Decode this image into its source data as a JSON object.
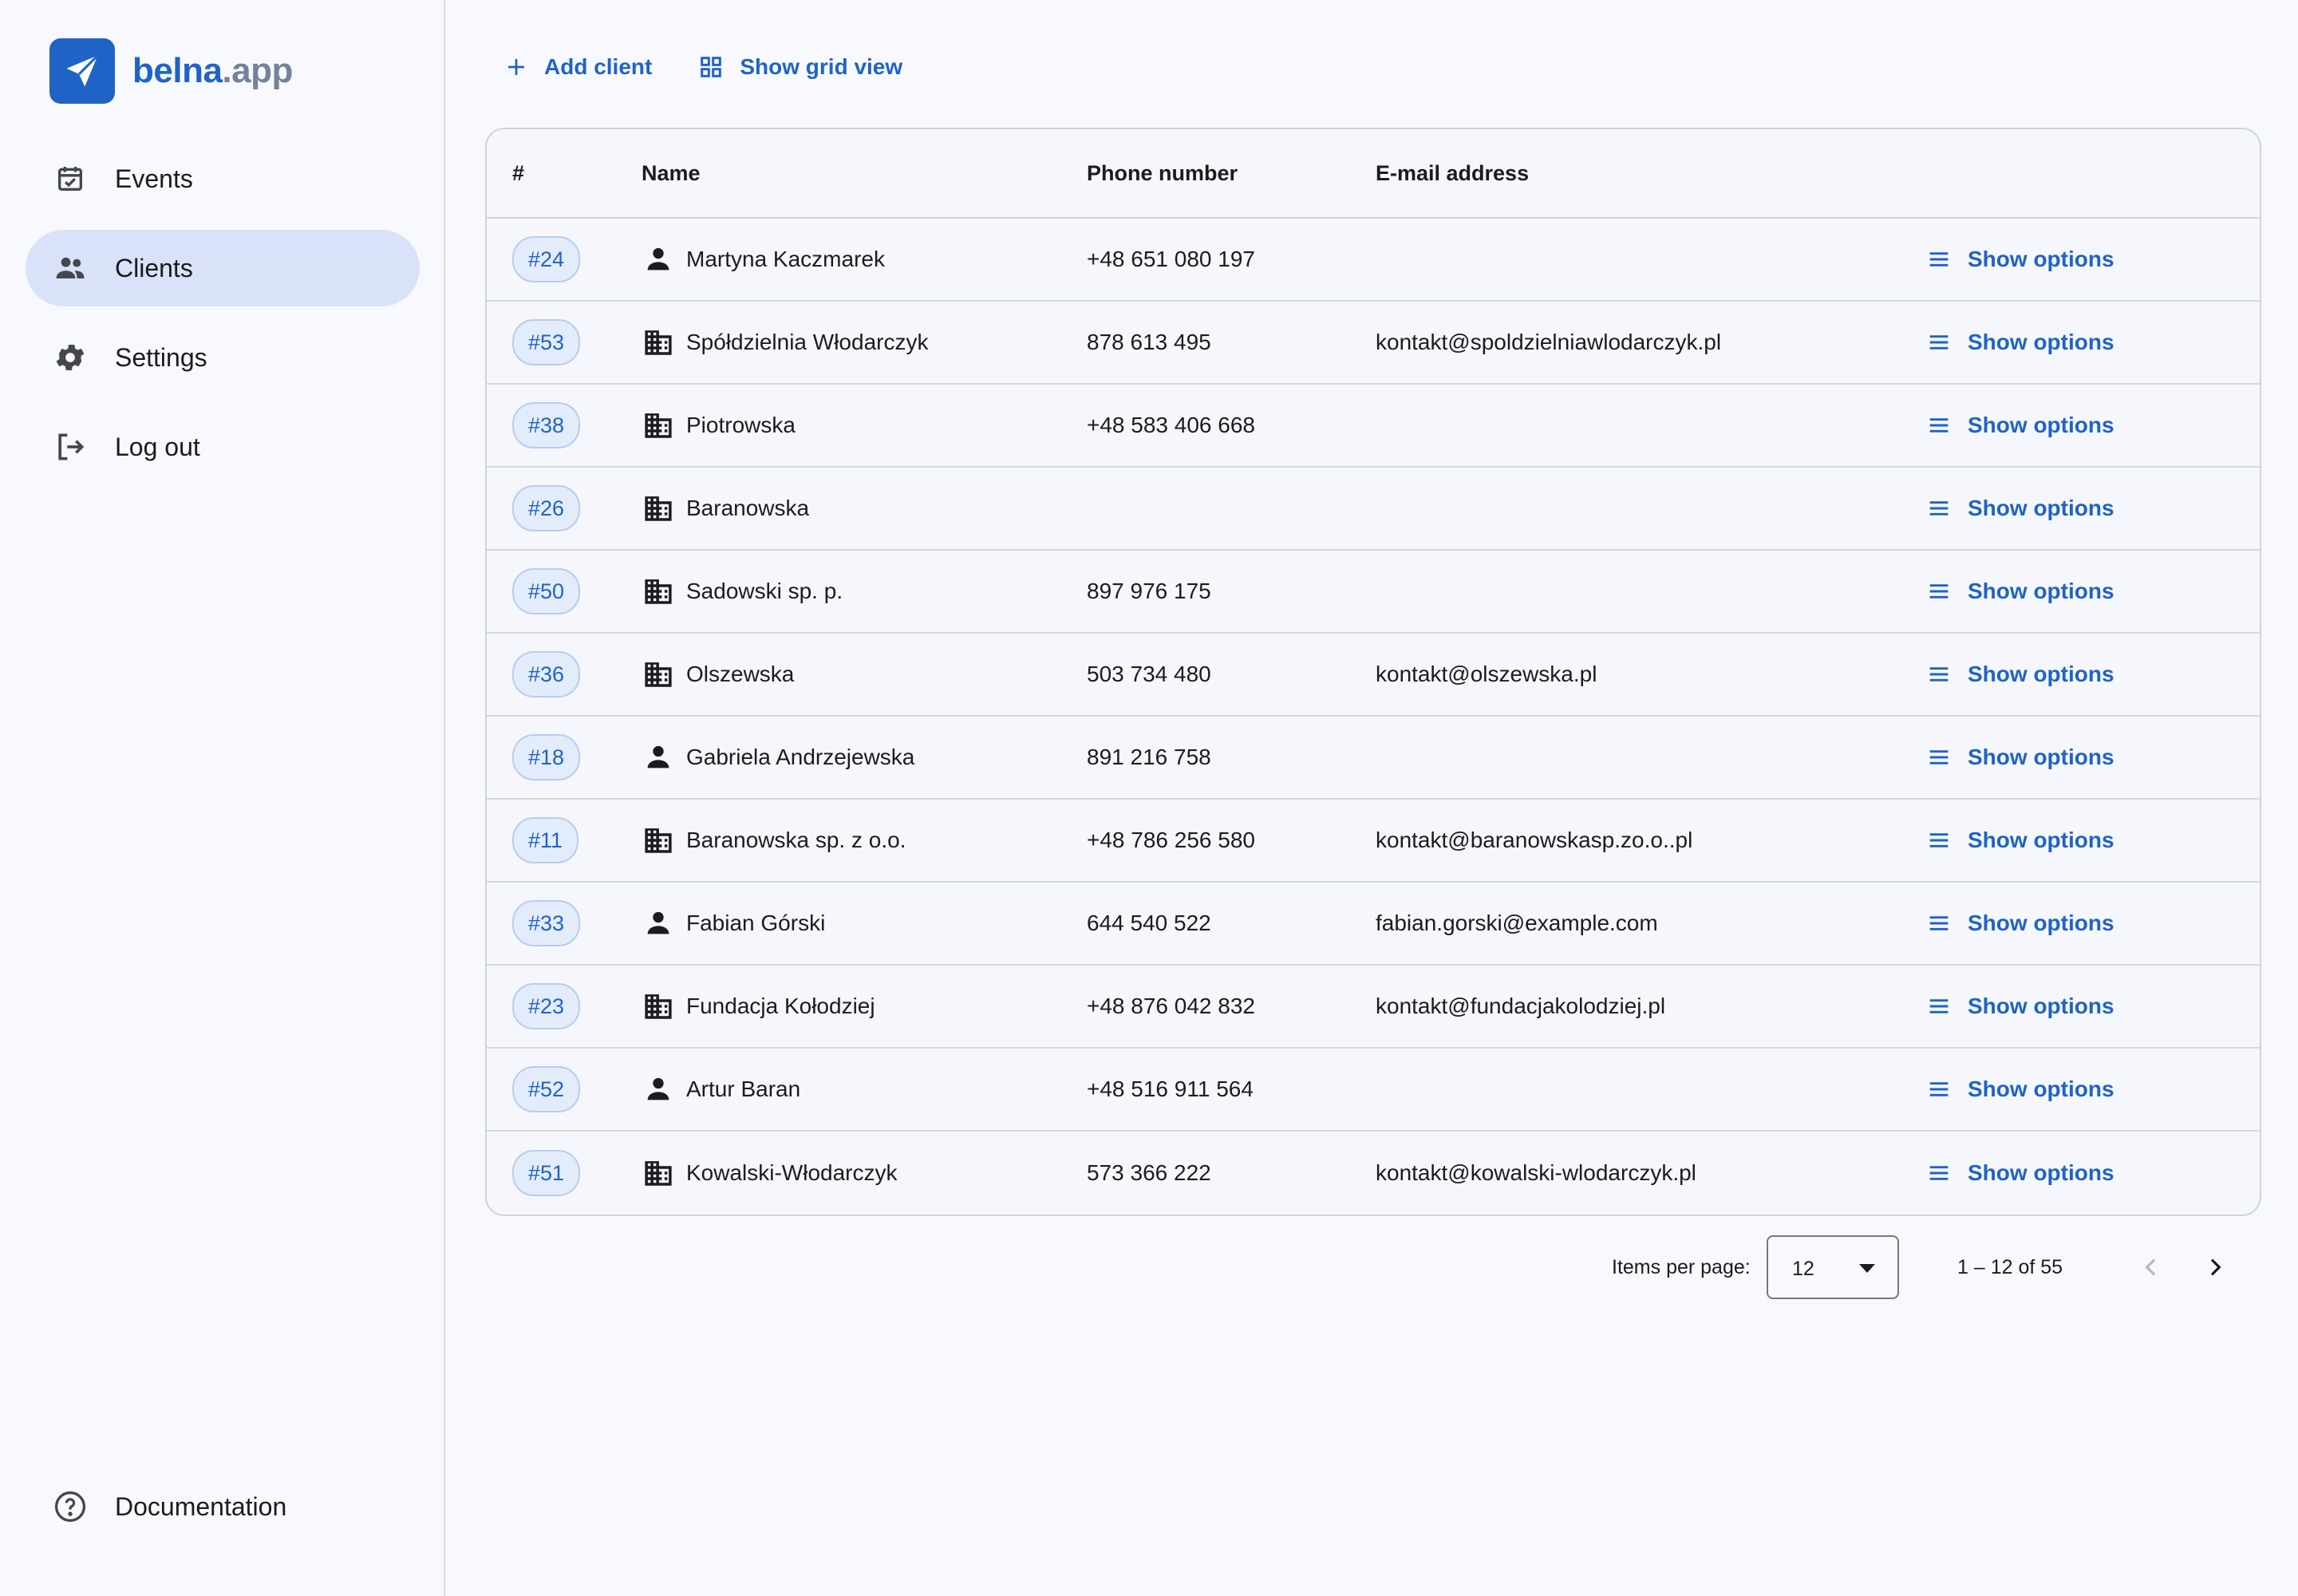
{
  "brand": {
    "name_part1": "belna",
    "name_part2": ".app"
  },
  "nav": {
    "items": [
      {
        "label": "Events",
        "icon": "calendar-check-icon",
        "active": false
      },
      {
        "label": "Clients",
        "icon": "people-icon",
        "active": true
      },
      {
        "label": "Settings",
        "icon": "gear-icon",
        "active": false
      },
      {
        "label": "Log out",
        "icon": "logout-icon",
        "active": false
      }
    ],
    "documentation": "Documentation"
  },
  "toolbar": {
    "add_client": "Add client",
    "grid_view": "Show grid view"
  },
  "table": {
    "headers": {
      "id": "#",
      "name": "Name",
      "phone": "Phone number",
      "email": "E-mail address"
    },
    "options_label": "Show options",
    "rows": [
      {
        "id": "#24",
        "type": "person",
        "name": "Martyna Kaczmarek",
        "phone": "+48 651 080 197",
        "email": ""
      },
      {
        "id": "#53",
        "type": "company",
        "name": "Spółdzielnia Włodarczyk",
        "phone": "878 613 495",
        "email": "kontakt@spoldzielniawlodarczyk.pl"
      },
      {
        "id": "#38",
        "type": "company",
        "name": "Piotrowska",
        "phone": "+48 583 406 668",
        "email": ""
      },
      {
        "id": "#26",
        "type": "company",
        "name": "Baranowska",
        "phone": "",
        "email": ""
      },
      {
        "id": "#50",
        "type": "company",
        "name": "Sadowski sp. p.",
        "phone": "897 976 175",
        "email": ""
      },
      {
        "id": "#36",
        "type": "company",
        "name": "Olszewska",
        "phone": "503 734 480",
        "email": "kontakt@olszewska.pl"
      },
      {
        "id": "#18",
        "type": "person",
        "name": "Gabriela Andrzejewska",
        "phone": "891 216 758",
        "email": ""
      },
      {
        "id": "#11",
        "type": "company",
        "name": "Baranowska sp. z o.o.",
        "phone": "+48 786 256 580",
        "email": "kontakt@baranowskasp.zo.o..pl"
      },
      {
        "id": "#33",
        "type": "person",
        "name": "Fabian Górski",
        "phone": "644 540 522",
        "email": "fabian.gorski@example.com"
      },
      {
        "id": "#23",
        "type": "company",
        "name": "Fundacja Kołodziej",
        "phone": "+48 876 042 832",
        "email": "kontakt@fundacjakolodziej.pl"
      },
      {
        "id": "#52",
        "type": "person",
        "name": "Artur Baran",
        "phone": "+48 516 911 564",
        "email": ""
      },
      {
        "id": "#51",
        "type": "company",
        "name": "Kowalski-Włodarczyk",
        "phone": "573 366 222",
        "email": "kontakt@kowalski-wlodarczyk.pl"
      }
    ]
  },
  "paginator": {
    "label": "Items per page:",
    "page_size": "12",
    "range": "1 – 12 of 55"
  },
  "colors": {
    "accent": "#1f63c6",
    "active_nav": "#dae2f9",
    "background": "#f8f9ff"
  }
}
